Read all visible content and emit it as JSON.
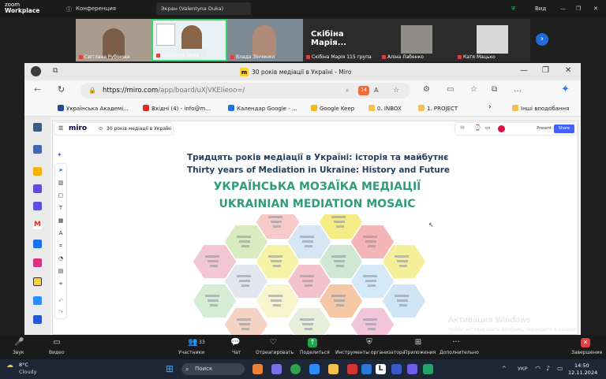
{
  "zoom": {
    "logo_line1": "zoom",
    "logo_line2": "Workplace",
    "conference": "Конференция",
    "screen_share": "Экран (Valentyna Duka)",
    "view": "Вид"
  },
  "participants": [
    {
      "name": "Світлана Рубінова"
    },
    {
      "name": "Valentyna Duka"
    },
    {
      "name": "Влада Зінченко"
    },
    {
      "name": "Скібіна Марія 115 група",
      "big_label": "Скібіна Марія..."
    },
    {
      "name": "Аліна Лабенко"
    },
    {
      "name": "Катя Мацько"
    }
  ],
  "browser": {
    "tab_title": "30 років медіації в Україні - Miro",
    "url_host": "https://miro.com",
    "url_path": "/app/board/uXjVKEIieoo=/",
    "badge": "14"
  },
  "bookmarks": [
    "Українська Академі...",
    "Вхідні (4) - info@m...",
    "Календар Google - ...",
    "Google Keep",
    "0. INBOX",
    "1. PROJECT",
    "Інші вподобання"
  ],
  "miro": {
    "logo": "miro",
    "board_name": "30 років медіації в Україні",
    "present": "Present",
    "share": "Share"
  },
  "board": {
    "title_ua": "Тридцять років медіації в Україні: історія та майбутнє",
    "title_en": "Thirty years of Mediation in Ukraine: History and Future",
    "mosaic_ua": "УКРАЇНСЬКА МОЗАЇКА МЕДІАЦІЇ",
    "mosaic_en": "UKRAINIAN MEDIATION MOSAIC"
  },
  "watermark": {
    "line1": "Активация Windows",
    "line2": "Чтобы активировать Windows, перейдите в раздел \"Параметры\"."
  },
  "controls": [
    {
      "label": "Звук",
      "icon": "mic-off-icon"
    },
    {
      "label": "Видео",
      "icon": "video-icon"
    },
    {
      "label": "Участники",
      "icon": "participants-icon",
      "count": "33"
    },
    {
      "label": "Чат",
      "icon": "chat-icon"
    },
    {
      "label": "Отреагировать",
      "icon": "react-icon"
    },
    {
      "label": "Поделиться",
      "icon": "share-icon"
    },
    {
      "label": "Инструменты организатора",
      "icon": "host-tools-icon"
    },
    {
      "label": "Приложения",
      "icon": "apps-icon"
    },
    {
      "label": "Дополнительно",
      "icon": "more-icon"
    },
    {
      "label": "Завершение",
      "icon": "end-icon"
    }
  ],
  "taskbar": {
    "weather_temp": "8°C",
    "weather_desc": "Cloudy",
    "search": "Поиск",
    "lang": "УКР",
    "time": "14:50",
    "date": "12.11.2024"
  }
}
